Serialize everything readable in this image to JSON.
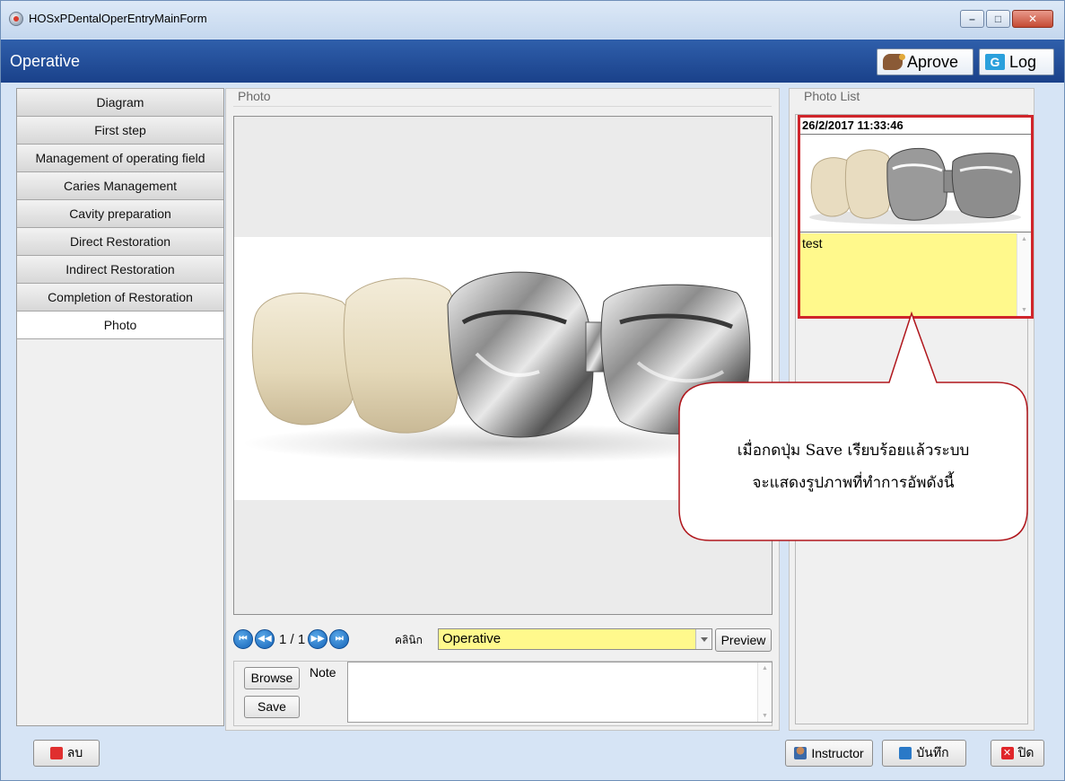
{
  "window": {
    "title": "HOSxPDentalOperEntryMainForm",
    "controls": {
      "minimize": "–",
      "maximize": "□",
      "close": "✕"
    }
  },
  "header": {
    "title": "Operative",
    "approve_label": "Aprove",
    "log_label": "Log",
    "log_icon_glyph": "G"
  },
  "tabs": [
    {
      "label": "Diagram",
      "active": false
    },
    {
      "label": "First step",
      "active": false
    },
    {
      "label": "Management of operating field",
      "active": false
    },
    {
      "label": "Caries Management",
      "active": false
    },
    {
      "label": "Cavity preparation",
      "active": false
    },
    {
      "label": "Direct Restoration",
      "active": false
    },
    {
      "label": "Indirect Restoration",
      "active": false
    },
    {
      "label": "Completion of Restoration",
      "active": false
    },
    {
      "label": "Photo",
      "active": true
    }
  ],
  "photo_panel": {
    "group_label": "Photo",
    "nav": {
      "first": "⏮",
      "prev": "◀◀",
      "page_indicator": "1 / 1",
      "next": "▶▶",
      "last": "⏭"
    },
    "clinic_label": "คลินิก",
    "clinic_value": "Operative",
    "preview_label": "Preview",
    "browse_label": "Browse",
    "save_label": "Save",
    "note_label": "Note",
    "note_value": ""
  },
  "photo_list": {
    "group_label": "Photo List",
    "items": [
      {
        "date": "26/2/2017 11:33:46",
        "note": "test"
      }
    ]
  },
  "callout": {
    "line1": "เมื่อกดปุ่ม Save เรียบร้อยแล้วระบบ",
    "line2": "จะแสดงรูปภาพที่ทำการอัพดังนี้"
  },
  "footer": {
    "delete_label": "ลบ",
    "instructor_label": "Instructor",
    "save_label": "บันทึก",
    "close_label": "ปิด"
  },
  "colors": {
    "header_bg": "#1f4a94",
    "highlight_border": "#d0252b",
    "input_yellow": "#fff98c",
    "nav_button_blue": "#1563b8"
  }
}
